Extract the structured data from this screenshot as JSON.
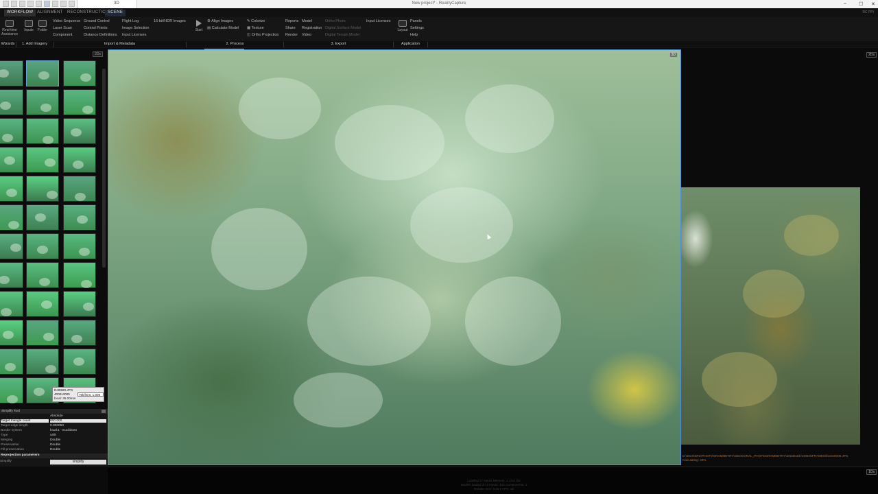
{
  "window": {
    "title": "New project* - RealityCapture",
    "active_tab": "3D",
    "controls": [
      "–",
      "☐",
      "✕"
    ]
  },
  "ribbon": {
    "tabs": [
      "WORKFLOW",
      "ALIGNMENT",
      "RECONSTRUCTION",
      "SCENE"
    ],
    "right_label": "RC PPI",
    "big_buttons": [
      "Start",
      "Inputs",
      "Folder"
    ],
    "wizards_label": "Real-time Assistance",
    "import": {
      "col1": [
        "Video Sequence",
        "Laser Scan",
        "Component"
      ],
      "col2": [
        "Ground Control",
        "Control Points",
        "Distance Definitions"
      ],
      "col3": [
        "Flight Log",
        "Image Selection",
        "Input Licenses"
      ],
      "col4": [
        "16-bit/HDR Images"
      ]
    },
    "process": {
      "start": "Start",
      "col1": [
        "Align Images",
        "Calculate Model"
      ],
      "col2": [
        "Colorize",
        "Texture",
        "Ortho Projection"
      ]
    },
    "export": {
      "col1": [
        "Reports",
        "Share",
        "Render"
      ],
      "col2": [
        "Model",
        "Registration",
        "Video"
      ],
      "col3": [
        "Ortho Photo",
        "Digital Surface Model",
        "Digital Terrain Model"
      ],
      "col4": [
        "Input Licenses"
      ]
    },
    "application": {
      "layout": "Layout",
      "col": [
        "Panels",
        "Settings",
        "Help"
      ]
    },
    "groups": [
      "Wizards",
      "1. Add Imagery",
      "Import & Metadata",
      "2. Process",
      "3. Export",
      "Application"
    ]
  },
  "left_panel": {
    "badge": "2Ds",
    "tooltip": {
      "name": "DJI0820.JPG",
      "size": "4000x3000",
      "focal": "focal: 35.00mm",
      "right": "76k/lens: 1.000"
    }
  },
  "tool_panel": {
    "title": "Simplify Tool",
    "rows": [
      {
        "k": "",
        "v": "Absolute"
      },
      {
        "k": "Target triangle count",
        "v": "800 000"
      },
      {
        "k": "Target edge length",
        "v": "0.000050"
      },
      {
        "k": "Border system",
        "v": "local:1 - Euclidean"
      },
      {
        "k": "Type",
        "v": "unlit"
      },
      {
        "k": "Merging",
        "v": "Double"
      },
      {
        "k": "Preservation",
        "v": "Double"
      },
      {
        "k": "Fill preservation",
        "v": "Double"
      }
    ],
    "section": "Reprojection parameters",
    "footer_label": "Simplify",
    "button": "simplify"
  },
  "main_view": {
    "badge": "3D"
  },
  "right_view": {
    "badge": "2Ds",
    "status": "D:\\2023\\SRC\\PHOTOGRAMMETRY\\GEOCORAL_PHOTOGRAMMETRY\\20230101\\VIDEO\\FRAMES\\frame0000.JPG",
    "status2": "Calculating: 49%"
  },
  "bottom": {
    "badge": "1Ds",
    "lines": [
      "Loading 17 inputs   Memory: 3.1/16 GB",
      "Models loaded 3 / 3  Inputs: 412  Components: 1",
      "Render time: 0.28 s    FPS: 18"
    ]
  }
}
